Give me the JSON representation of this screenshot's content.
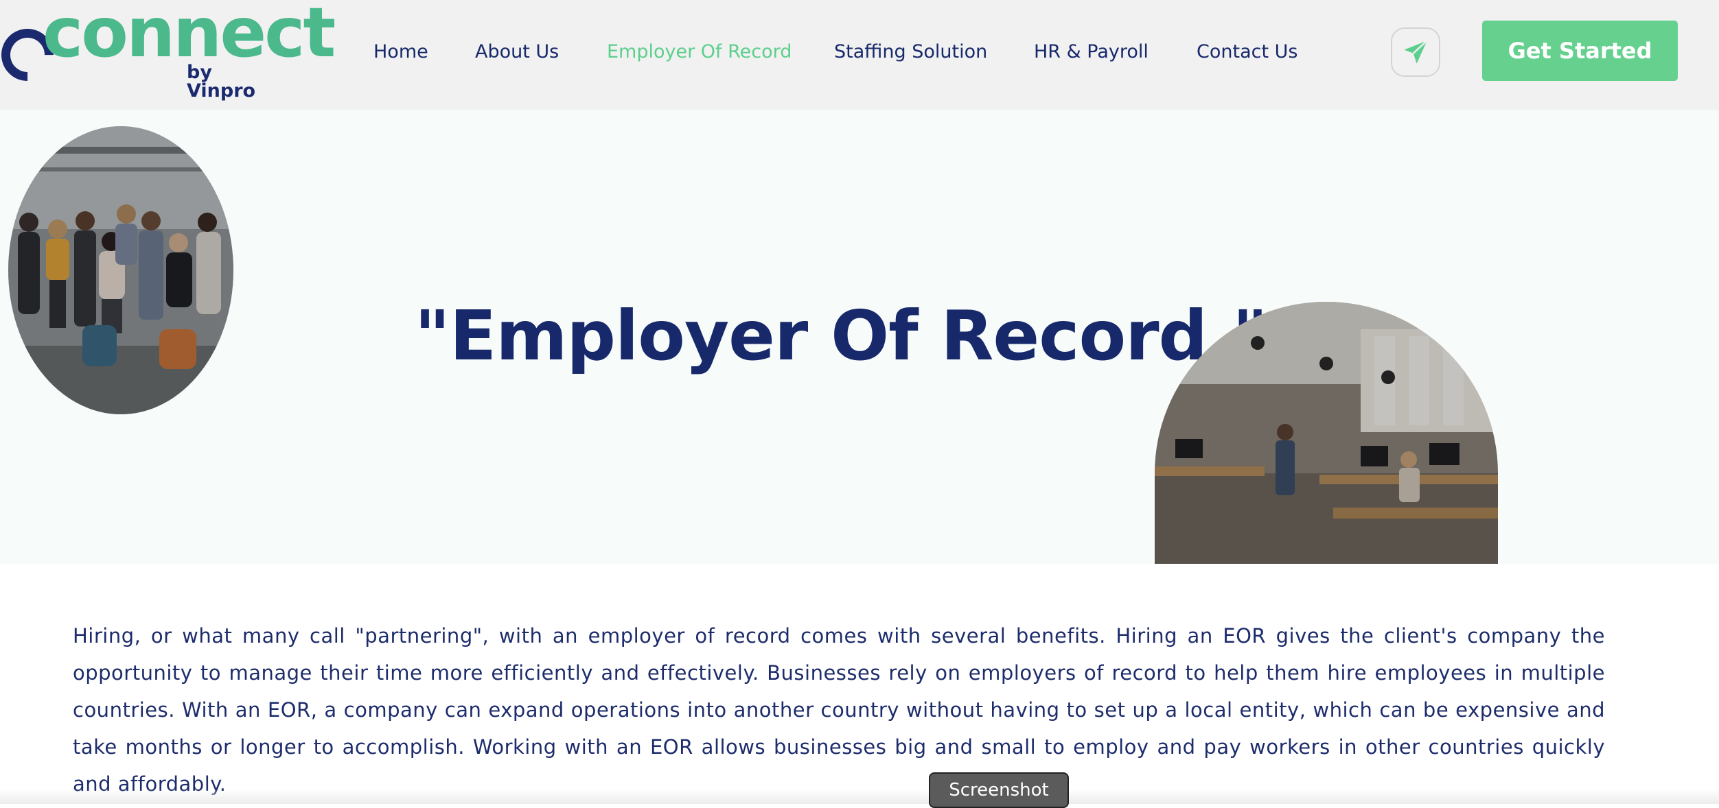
{
  "brand": {
    "logo_text": "connect",
    "logo_sub": "by Vinpro",
    "primary_color": "#17296b",
    "accent_color": "#4cb98c",
    "cta_color": "#66d18f"
  },
  "nav": {
    "items": [
      {
        "label": "Home",
        "active": false
      },
      {
        "label": "About Us",
        "active": false
      },
      {
        "label": "Employer Of Record",
        "active": true
      },
      {
        "label": "Staffing Solution",
        "active": false
      },
      {
        "label": "HR & Payroll",
        "active": false
      },
      {
        "label": "Contact Us",
        "active": false
      }
    ],
    "send_icon": "paper-plane-icon",
    "cta_label": "Get Started"
  },
  "hero": {
    "title": "\"Employer Of Record.\"",
    "left_image": "team-group-photo",
    "right_image": "office-interior-photo"
  },
  "content": {
    "paragraph": "Hiring, or what many call \"partnering\", with an employer of record comes with several benefits. Hiring an EOR gives the client's company the opportunity to manage their time more efficiently and effectively. Businesses rely on employers of record to help them hire employees in multiple countries. With an EOR, a company can expand operations into another country without having to set up a local entity, which can be expensive and take months or longer to accomplish. Working with an EOR allows businesses big and small to employ and pay workers in other countries quickly and affordably."
  },
  "overlay": {
    "tooltip": "Screenshot"
  }
}
